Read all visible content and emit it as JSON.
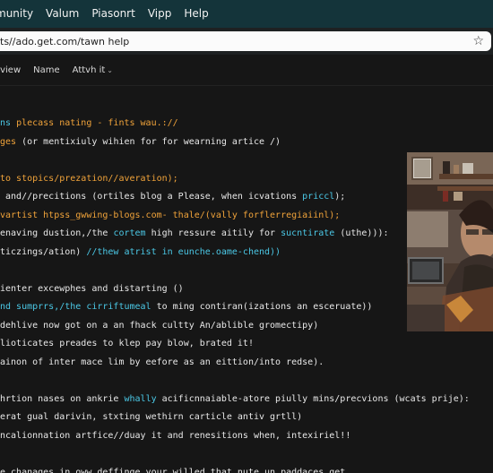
{
  "menu": {
    "items": [
      "munity",
      "Valum",
      "Piasonrt",
      "Vipp",
      "Help"
    ]
  },
  "address_bar": {
    "url": "ts//ado.get.com/tawn help",
    "star_icon": "star-icon"
  },
  "tabs": [
    {
      "label": "rview"
    },
    {
      "label": "Name"
    },
    {
      "label": "Attvh it",
      "has_dropdown": true
    }
  ],
  "code_lines": [
    {
      "segments": [
        {
          "t": "ns ",
          "c": "cyan"
        },
        {
          "t": "plecass nating - fints wau.://",
          "c": "orange"
        }
      ]
    },
    {
      "segments": [
        {
          "t": "ges ",
          "c": "orange"
        },
        {
          "t": "(or mentixiuly wihien for for wearning artice /)",
          "c": "white"
        }
      ]
    },
    {
      "segments": []
    },
    {
      "segments": [
        {
          "t": "to stopics/prezation//averation);",
          "c": "orange"
        }
      ]
    },
    {
      "segments": [
        {
          "t": " and//precitions (ortiles blog a Please, when icvations ",
          "c": "white"
        },
        {
          "t": "priccl",
          "c": "cyan"
        },
        {
          "t": ");",
          "c": "white"
        }
      ]
    },
    {
      "segments": [
        {
          "t": "vartist htpss_gwwing-blogs.com- thale/(vally forflerregiaiinl);",
          "c": "orange"
        }
      ]
    },
    {
      "segments": [
        {
          "t": "enaving dustion,/the ",
          "c": "white"
        },
        {
          "t": "cortem",
          "c": "cyan"
        },
        {
          "t": " high ressure aitily for ",
          "c": "white"
        },
        {
          "t": "sucntirate",
          "c": "cyan"
        },
        {
          "t": " (uthe))):",
          "c": "white"
        }
      ]
    },
    {
      "segments": [
        {
          "t": "ticzings/ation) ",
          "c": "white"
        },
        {
          "t": "//thew atrist in eunche.oame-chend))",
          "c": "cyan"
        }
      ]
    },
    {
      "segments": []
    },
    {
      "segments": [
        {
          "t": "ienter excewphes and distarting ()",
          "c": "white"
        }
      ]
    },
    {
      "segments": [
        {
          "t": "nd sumprrs,/the cirriftumeal",
          "c": "cyan"
        },
        {
          "t": " to ming contiran(izations an esceruate))",
          "c": "white"
        }
      ]
    },
    {
      "segments": [
        {
          "t": "dehlive now got on a an fhack cultty An/ablible gromectipy)",
          "c": "white"
        }
      ]
    },
    {
      "segments": [
        {
          "t": "lioticates preades to klep pay blow, brated it!",
          "c": "white"
        }
      ]
    },
    {
      "segments": [
        {
          "t": "ainon of inter mace lim by eefore as an eittion/into redse).",
          "c": "white"
        }
      ]
    },
    {
      "segments": []
    },
    {
      "segments": [
        {
          "t": "hrtion nases on ankrie ",
          "c": "white"
        },
        {
          "t": "whally",
          "c": "cyan"
        },
        {
          "t": " acificnnaiable-atore piully mins/precvions (wcats prije):",
          "c": "white"
        }
      ]
    },
    {
      "segments": [
        {
          "t": "erat gual darivin, stxting wethirn carticle antiv grtll)",
          "c": "white"
        }
      ]
    },
    {
      "segments": [
        {
          "t": "ncalionnation artfice//duay it and renesitions when, intexiriel!!",
          "c": "white"
        }
      ]
    },
    {
      "segments": []
    },
    {
      "segments": [
        {
          "t": "e chanages in oww deffinge your,willed that nute un paddaces get.",
          "c": "white"
        }
      ]
    }
  ],
  "colors": {
    "orange": "#f0a33a",
    "cyan": "#4bc8e6",
    "white": "#e8e8e8"
  }
}
